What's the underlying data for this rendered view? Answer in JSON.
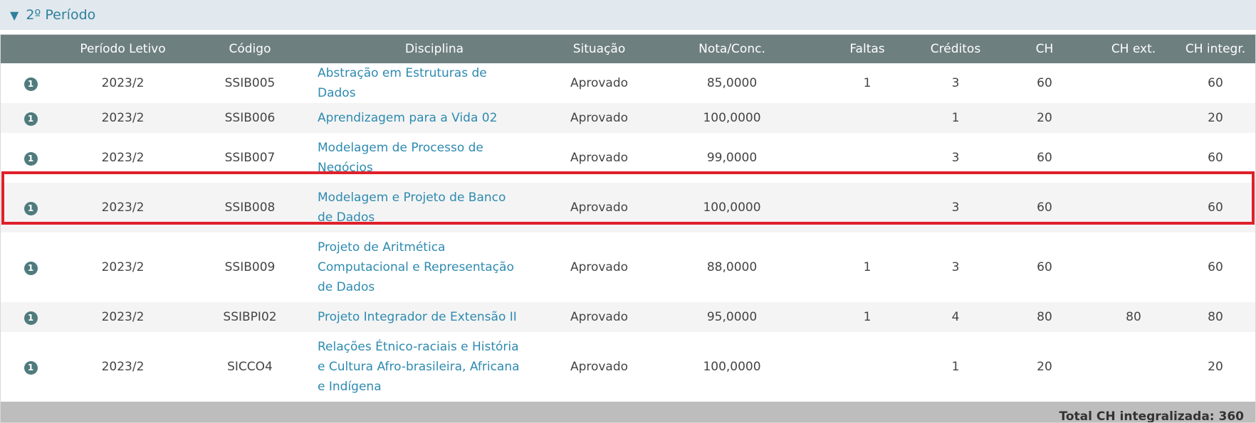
{
  "section": {
    "toggle_icon": "▼",
    "title": "2º Período"
  },
  "table": {
    "headers": [
      "",
      "Período Letivo",
      "Código",
      "Disciplina",
      "Situação",
      "Nota/Conc.",
      "Faltas",
      "Créditos",
      "CH",
      "CH ext.",
      "CH integr."
    ],
    "rows": [
      {
        "info": "1",
        "periodo": "2023/2",
        "codigo": "SSIB005",
        "disciplina": "Abstração em Estruturas de Dados",
        "situacao": "Aprovado",
        "nota": "85,0000",
        "faltas": "1",
        "creditos": "3",
        "ch": "60",
        "ch_ext": "",
        "ch_integr": "60"
      },
      {
        "info": "1",
        "periodo": "2023/2",
        "codigo": "SSIB006",
        "disciplina": "Aprendizagem para a Vida 02",
        "situacao": "Aprovado",
        "nota": "100,0000",
        "faltas": "",
        "creditos": "1",
        "ch": "20",
        "ch_ext": "",
        "ch_integr": "20"
      },
      {
        "info": "1",
        "periodo": "2023/2",
        "codigo": "SSIB007",
        "disciplina": "Modelagem de Processo de Negócios",
        "situacao": "Aprovado",
        "nota": "99,0000",
        "faltas": "",
        "creditos": "3",
        "ch": "60",
        "ch_ext": "",
        "ch_integr": "60"
      },
      {
        "info": "1",
        "periodo": "2023/2",
        "codigo": "SSIB008",
        "disciplina": "Modelagem e Projeto de Banco de Dados",
        "situacao": "Aprovado",
        "nota": "100,0000",
        "faltas": "",
        "creditos": "3",
        "ch": "60",
        "ch_ext": "",
        "ch_integr": "60"
      },
      {
        "info": "1",
        "periodo": "2023/2",
        "codigo": "SSIB009",
        "disciplina": "Projeto de Aritmética Computacional e Representação de Dados",
        "situacao": "Aprovado",
        "nota": "88,0000",
        "faltas": "1",
        "creditos": "3",
        "ch": "60",
        "ch_ext": "",
        "ch_integr": "60"
      },
      {
        "info": "1",
        "periodo": "2023/2",
        "codigo": "SSIBPI02",
        "disciplina": "Projeto Integrador de Extensão II",
        "situacao": "Aprovado",
        "nota": "95,0000",
        "faltas": "1",
        "creditos": "4",
        "ch": "80",
        "ch_ext": "80",
        "ch_integr": "80"
      },
      {
        "info": "1",
        "periodo": "2023/2",
        "codigo": "SICCO4",
        "disciplina": "Relações Étnico-raciais e História e Cultura Afro-brasileira, Africana e Indígena",
        "situacao": "Aprovado",
        "nota": "100,0000",
        "faltas": "",
        "creditos": "1",
        "ch": "20",
        "ch_ext": "",
        "ch_integr": "20"
      }
    ],
    "footer": "Total CH integralizada: 360"
  },
  "colors": {
    "header_bg": "#6e7f80",
    "section_bg": "#e1e9ee",
    "link": "#2e8ab0",
    "highlight": "#e0202a",
    "footer_bg": "#bdbdbd"
  }
}
